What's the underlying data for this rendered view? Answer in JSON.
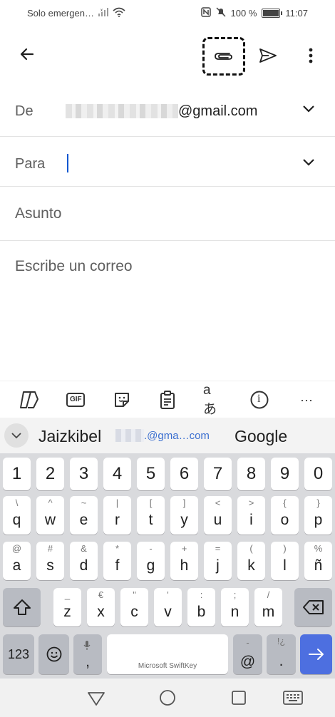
{
  "status": {
    "carrier": "Solo emergen…",
    "battery": "100 %",
    "time": "11:07"
  },
  "compose": {
    "from_label": "De",
    "from_value": "@gmail.com",
    "to_label": "Para",
    "subject_placeholder": "Asunto",
    "body_placeholder": "Escribe un correo"
  },
  "toolbar": {
    "gif": "GIF",
    "translate": "aあ",
    "info": "i",
    "more": "···"
  },
  "suggestions": {
    "word1": "Jaizkibel",
    "email": ".@gma…com",
    "word3": "Google"
  },
  "keyboard": {
    "row_numbers": [
      "1",
      "2",
      "3",
      "4",
      "5",
      "6",
      "7",
      "8",
      "9",
      "0"
    ],
    "row1": [
      [
        "\\",
        "q"
      ],
      [
        "^",
        "w"
      ],
      [
        "~",
        "e"
      ],
      [
        "|",
        "r"
      ],
      [
        "[",
        "t"
      ],
      [
        "]",
        "y"
      ],
      [
        "<",
        "u"
      ],
      [
        ">",
        "i"
      ],
      [
        "{",
        "o"
      ],
      [
        "}",
        "p"
      ]
    ],
    "row2": [
      [
        "@",
        "a"
      ],
      [
        "#",
        "s"
      ],
      [
        "&",
        "d"
      ],
      [
        "*",
        "f"
      ],
      [
        "-",
        "g"
      ],
      [
        "+",
        "h"
      ],
      [
        "=",
        "j"
      ],
      [
        "(",
        "k"
      ],
      [
        ")",
        "l"
      ],
      [
        "%",
        "ñ"
      ]
    ],
    "row3": [
      [
        "_",
        "z"
      ],
      [
        "€",
        "x"
      ],
      [
        "\"",
        "c"
      ],
      [
        "'",
        "v"
      ],
      [
        ":",
        "b"
      ],
      [
        ";",
        "n"
      ],
      [
        "/",
        "m"
      ]
    ],
    "key_123": "123",
    "key_comma": ",",
    "key_at": "@",
    "key_period": ".",
    "key_period_hint": "!¿",
    "space_label": "Microsoft SwiftKey"
  },
  "colors": {
    "accent": "#0b57d0",
    "enter_key": "#4d6fe0"
  }
}
